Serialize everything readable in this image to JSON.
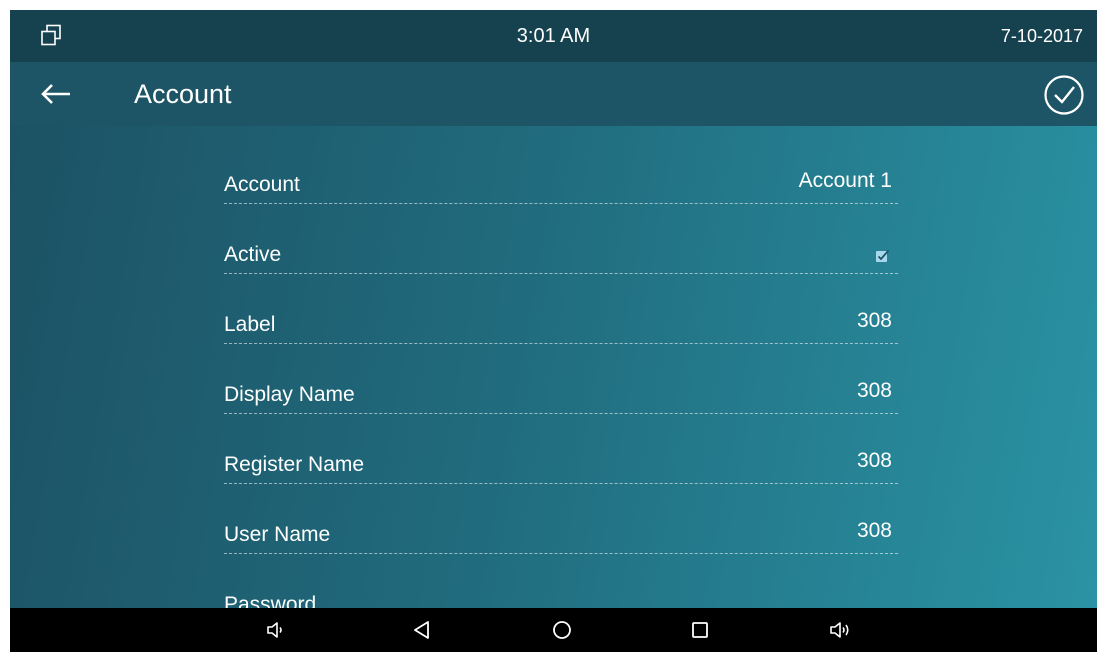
{
  "status_bar": {
    "time": "3:01 AM",
    "date": "7-10-2017"
  },
  "header": {
    "title": "Account"
  },
  "settings": {
    "rows": [
      {
        "label": "Account",
        "value": "Account 1"
      },
      {
        "label": "Active",
        "checked": true
      },
      {
        "label": "Label",
        "value": "308"
      },
      {
        "label": "Display Name",
        "value": "308"
      },
      {
        "label": "Register Name",
        "value": "308"
      },
      {
        "label": "User Name",
        "value": "308"
      },
      {
        "label": "Password",
        "value": ""
      }
    ]
  },
  "icons": {
    "status_left": "windows-icon",
    "back": "arrow-left-icon",
    "confirm": "check-circle-icon",
    "nav": [
      "volume-down-icon",
      "back-triangle-icon",
      "home-circle-icon",
      "recents-square-icon",
      "volume-up-icon"
    ]
  },
  "colors": {
    "status_bar": "#16424f",
    "title_bar": "#1d5566",
    "content_start": "#1c5264",
    "content_end": "#2a93a4",
    "checkbox": "#a8d8ee"
  }
}
